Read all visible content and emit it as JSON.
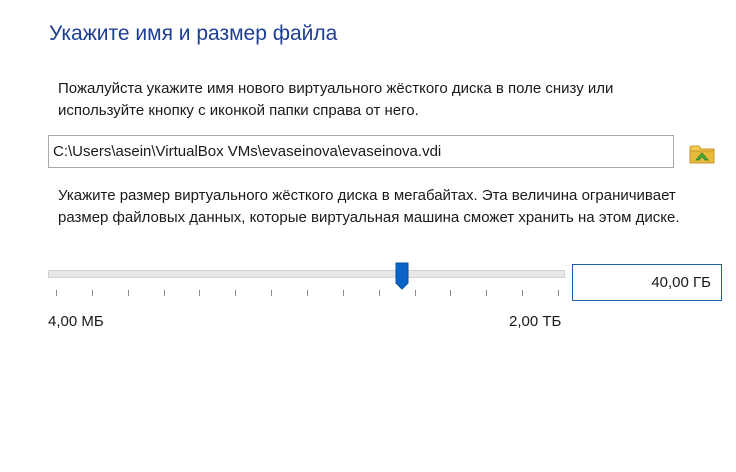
{
  "title": "Укажите имя и размер файла",
  "file_location": {
    "description": "Пожалуйста укажите имя нового виртуального жёсткого диска в поле снизу или используйте кнопку с иконкой папки справа от него.",
    "path_value": "C:\\Users\\asein\\VirtualBox VMs\\evaseinova\\evaseinova.vdi",
    "folder_icon": "folder-browse-icon"
  },
  "file_size": {
    "description": "Укажите размер виртуального жёсткого диска в мегабайтах. Эта величина ограничивает размер файловых данных, которые виртуальная машина сможет хранить на этом диске.",
    "size_value": "40,00 ГБ",
    "slider_level": 0.69,
    "min_label": "4,00 МБ",
    "max_label": "2,00 ТБ"
  },
  "colors": {
    "title": "#1c3f94",
    "accent": "#0a64c8",
    "folder": "#e8b93a",
    "folder_arrow": "#4caf3e"
  }
}
